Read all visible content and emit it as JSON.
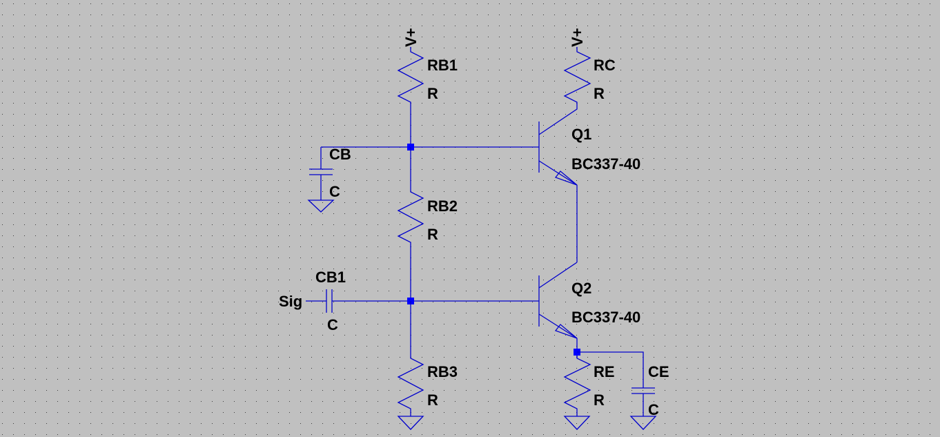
{
  "colors": {
    "background": "#c0c0c0",
    "wire": "#0000cc",
    "junction": "#0000ff",
    "grid_dot": "#000000"
  },
  "supplies": [
    {
      "label": "V+"
    },
    {
      "label": "V+"
    }
  ],
  "components": {
    "RB1": {
      "name": "RB1",
      "value": "R"
    },
    "RC": {
      "name": "RC",
      "value": "R"
    },
    "Q1": {
      "name": "Q1",
      "model": "BC337-40"
    },
    "CB": {
      "name": "CB",
      "value": "C"
    },
    "RB2": {
      "name": "RB2",
      "value": "R"
    },
    "CB1": {
      "name": "CB1",
      "value": "C"
    },
    "Q2": {
      "name": "Q2",
      "model": "BC337-40"
    },
    "RB3": {
      "name": "RB3",
      "value": "R"
    },
    "RE": {
      "name": "RE",
      "value": "R"
    },
    "CE": {
      "name": "CE",
      "value": "C"
    }
  },
  "net_labels": {
    "input": "Sig"
  }
}
